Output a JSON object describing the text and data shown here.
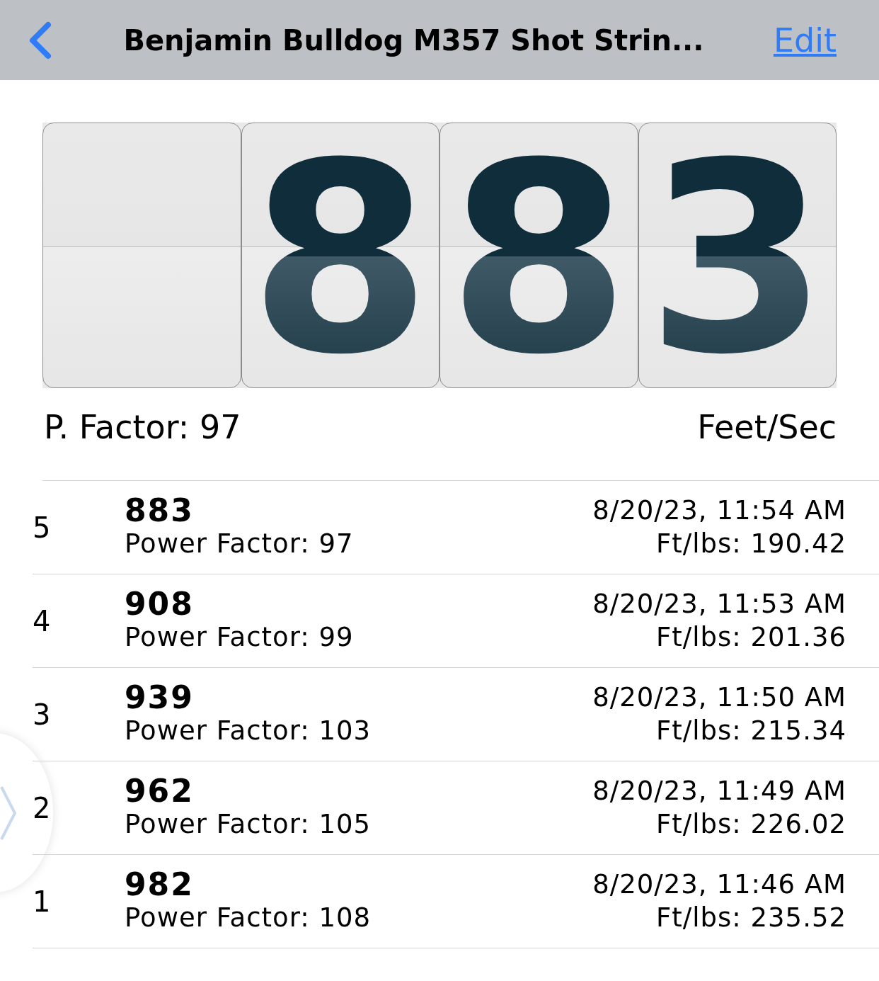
{
  "nav": {
    "title": "Benjamin Bulldog M357 Shot Strin...",
    "action": "Edit"
  },
  "display": {
    "digits": [
      "8",
      "8",
      "3"
    ]
  },
  "summary": {
    "left": "P. Factor: 97",
    "right": "Feet/Sec"
  },
  "shots": [
    {
      "index": "5",
      "velocity": "883",
      "power": "Power Factor: 97",
      "time": "8/20/23, 11:54 AM",
      "energy": "Ft/lbs: 190.42"
    },
    {
      "index": "4",
      "velocity": "908",
      "power": "Power Factor: 99",
      "time": "8/20/23, 11:53 AM",
      "energy": "Ft/lbs: 201.36"
    },
    {
      "index": "3",
      "velocity": "939",
      "power": "Power Factor: 103",
      "time": "8/20/23, 11:50 AM",
      "energy": "Ft/lbs: 215.34"
    },
    {
      "index": "2",
      "velocity": "962",
      "power": "Power Factor: 105",
      "time": "8/20/23, 11:49 AM",
      "energy": "Ft/lbs: 226.02"
    },
    {
      "index": "1",
      "velocity": "982",
      "power": "Power Factor: 108",
      "time": "8/20/23, 11:46 AM",
      "energy": "Ft/lbs: 235.52"
    }
  ]
}
